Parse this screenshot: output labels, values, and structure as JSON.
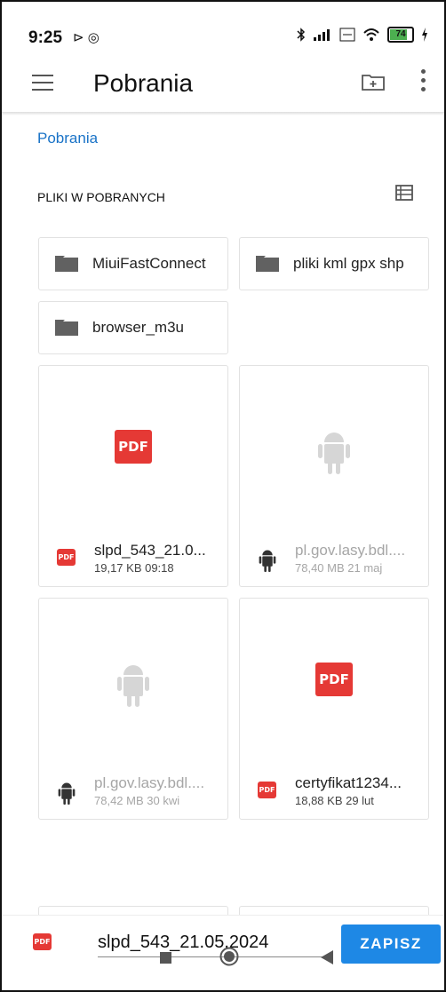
{
  "status_bar": {
    "time": "9:25",
    "left_icons": "⊳ ◎",
    "signal_text": "ᵛᵒ",
    "battery": "74",
    "battery_color": "#4caf50"
  },
  "toolbar": {
    "title": "Pobrania",
    "menu_icon": "hamburger-icon",
    "new_folder_icon": "new-folder-icon",
    "more_icon": "more-vert-icon"
  },
  "breadcrumb": "Pobrania",
  "section": {
    "title": "PLIKI W POBRANYCH",
    "view_toggle_icon": "list-view-icon"
  },
  "folders": [
    {
      "label": "MiuiFastConnect"
    },
    {
      "label": "pliki kml gpx shp"
    },
    {
      "label": "browser_m3u"
    }
  ],
  "files": [
    {
      "name": "slpd_543_21.0...",
      "info": "19,17 KB 09:18",
      "type": "pdf"
    },
    {
      "name": "pl.gov.lasy.bdl....",
      "info": "78,40 MB 21 maj",
      "type": "apk"
    },
    {
      "name": "pl.gov.lasy.bdl....",
      "info": "78,42 MB 30 kwi",
      "type": "apk"
    },
    {
      "name": "certyfikat1234...",
      "info": "18,88 KB 29 lut",
      "type": "pdf"
    }
  ],
  "save_bar": {
    "filename": "slpd_543_21.05.2024",
    "save_label": "ZAPISZ",
    "accent": "#1e88e5"
  },
  "pdf_label": "PDF"
}
